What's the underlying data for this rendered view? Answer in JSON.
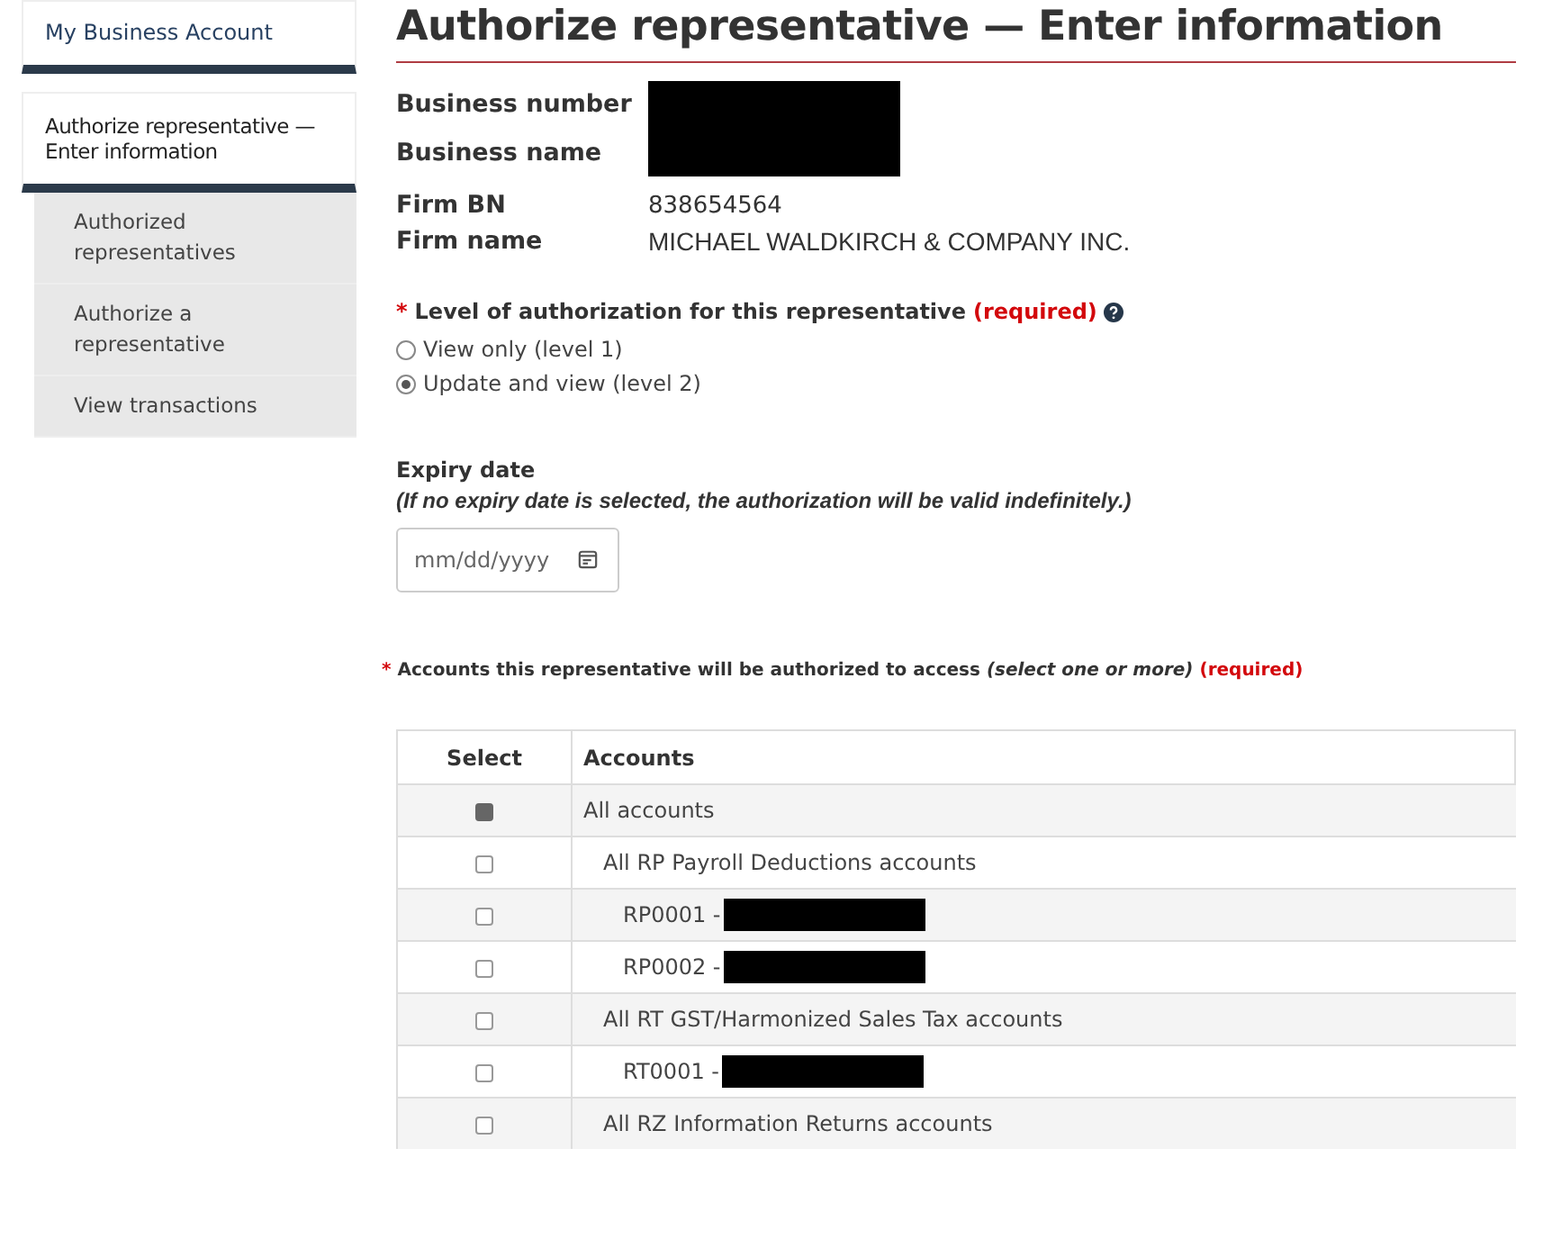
{
  "sidebar": {
    "home": "My Business Account",
    "current": "Authorize representative — Enter information",
    "items": [
      {
        "label": "Authorized representatives",
        "selected": false
      },
      {
        "label": "Authorize a representative",
        "selected": false
      },
      {
        "label": "View transactions",
        "selected": false
      }
    ]
  },
  "title": "Authorize representative — Enter information",
  "business": [
    {
      "label": "Business number",
      "redacted": true
    },
    {
      "label": "Business name",
      "redacted": true
    }
  ],
  "firm": [
    {
      "label": "Firm BN",
      "value": "838654564"
    },
    {
      "label": "Firm name",
      "value": "MICHAEL WALDKIRCH & COMPANY INC."
    }
  ],
  "authorization": {
    "asterisk": "*",
    "label": "Level of authorization for this representative",
    "required": "(required)",
    "options": [
      {
        "label": "View only (level 1)",
        "selected": false
      },
      {
        "label": "Update and view (level 2)",
        "selected": true
      }
    ]
  },
  "expiry": {
    "label": "Expiry date",
    "note": "(If no expiry date is selected, the authorization will be valid indefinitely.)",
    "placeholder": "mm/dd/yyyy"
  },
  "accounts": {
    "asterisk": "*",
    "label": "Accounts this representative will be authorized to access",
    "hint": "(select one or more)",
    "required": "(required)",
    "columns": [
      "Select",
      "Accounts"
    ],
    "rows": [
      {
        "label": "All accounts",
        "checked": true,
        "children": [
          {
            "label": "All RP Payroll Deductions accounts",
            "checked": false,
            "children": [
              {
                "label": "RP0001 -",
                "checked": false,
                "redacted": true
              },
              {
                "label": "RP0002 -",
                "checked": false,
                "redacted": true
              }
            ]
          },
          {
            "label": "All RT GST/Harmonized Sales Tax accounts",
            "checked": false,
            "children": [
              {
                "label": "RT0001 -",
                "checked": false,
                "redacted": true
              }
            ]
          },
          {
            "label": "All RZ Information Returns accounts",
            "checked": false
          }
        ]
      }
    ]
  }
}
